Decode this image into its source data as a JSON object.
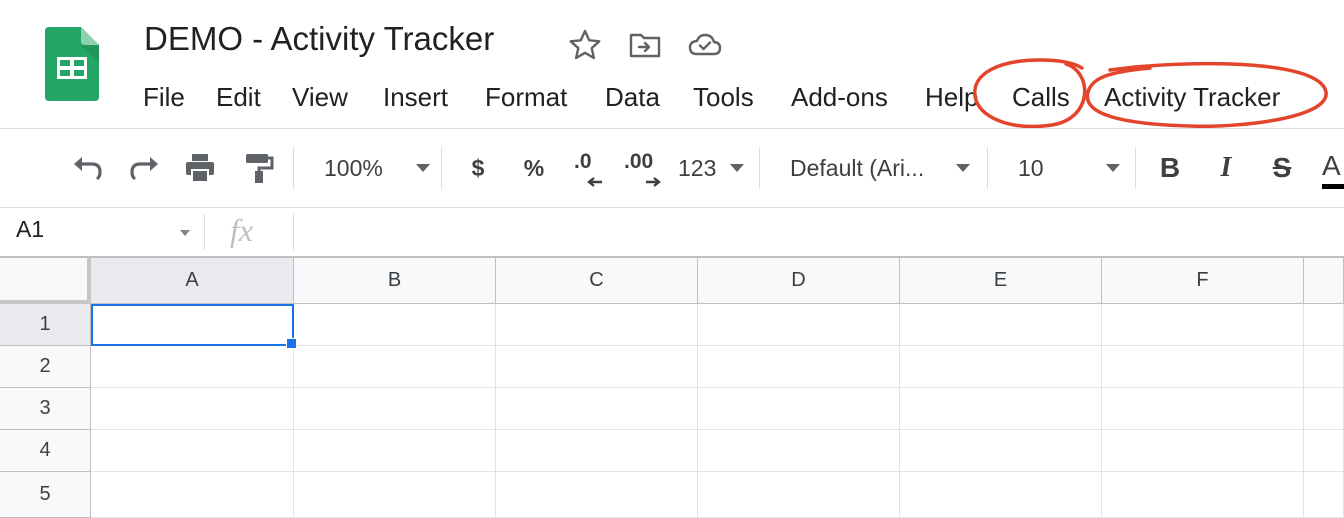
{
  "document": {
    "title": "DEMO - Activity Tracker",
    "icons": [
      "star-icon",
      "move-to-folder-icon",
      "cloud-saved-icon"
    ]
  },
  "colors": {
    "sheets_green": "#23a566",
    "selection_blue": "#1a73e8",
    "annotation_red": "#e3452c"
  },
  "menu": [
    "File",
    "Edit",
    "View",
    "Insert",
    "Format",
    "Data",
    "Tools",
    "Add-ons",
    "Help",
    "Calls",
    "Activity Tracker"
  ],
  "annotations": {
    "circled_menus": [
      "Calls",
      "Activity Tracker"
    ]
  },
  "toolbar": {
    "zoom": "100%",
    "currency": "$",
    "percent": "%",
    "decrease_decimal": ".0",
    "increase_decimal": ".00",
    "more_formats": "123",
    "font": "Default (Ari...",
    "font_size": "10",
    "bold": "B",
    "italic": "I",
    "strikethrough": "S",
    "text_color": "A"
  },
  "formula_bar": {
    "name_box": "A1",
    "fx": "fx",
    "value": ""
  },
  "grid": {
    "columns": [
      "A",
      "B",
      "C",
      "D",
      "E",
      "F"
    ],
    "rows": [
      "1",
      "2",
      "3",
      "4",
      "5"
    ],
    "selected_cell": "A1"
  }
}
